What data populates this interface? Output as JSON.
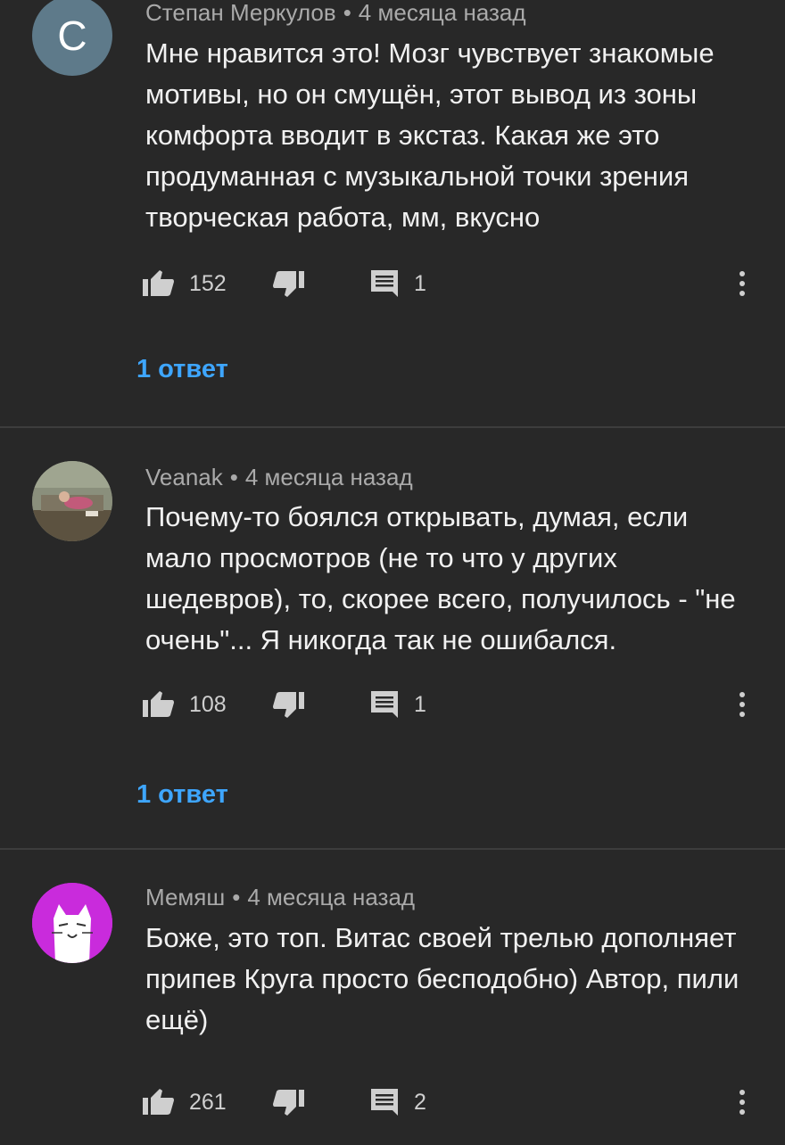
{
  "comments": [
    {
      "avatar_letter": "С",
      "avatar_color": "#5e7a8a",
      "author": "Степан Меркулов",
      "separator": "•",
      "time": "4 месяца назад",
      "text": "Мне нравится это! Мозг чувствует знакомые мотивы, но он смущён, этот вывод из зоны комфорта вводит в экстаз. Какая же это продуманная с музыкальной точки зрения творческая работа, мм, вкусно",
      "likes": "152",
      "replies_count": "1",
      "replies_link": "1 ответ"
    },
    {
      "avatar_color": "#6b7060",
      "author": "Veanak",
      "separator": "•",
      "time": "4 месяца назад",
      "text": "Почему-то боялся открывать, думая, если мало просмотров (не то что у других шедевров), то, скорее всего, получилось - \"не очень\"... Я никогда так не ошибался.",
      "likes": "108",
      "replies_count": "1",
      "replies_link": "1 ответ"
    },
    {
      "avatar_color": "#c92bdc",
      "author": "Мемяш",
      "separator": "•",
      "time": "4 месяца назад",
      "text": "Боже, это топ. Витас своей трелью дополняет припев Круга просто бесподобно) Автор, пили ещё)",
      "likes": "261",
      "replies_count": "2"
    }
  ],
  "colors": {
    "background": "#282828",
    "link": "#3ea6ff",
    "meta_text": "#aaaaaa",
    "divider": "#3d3d3d"
  },
  "icons": [
    "thumb-up-icon",
    "thumb-down-icon",
    "comment-icon",
    "more-vert-icon"
  ]
}
